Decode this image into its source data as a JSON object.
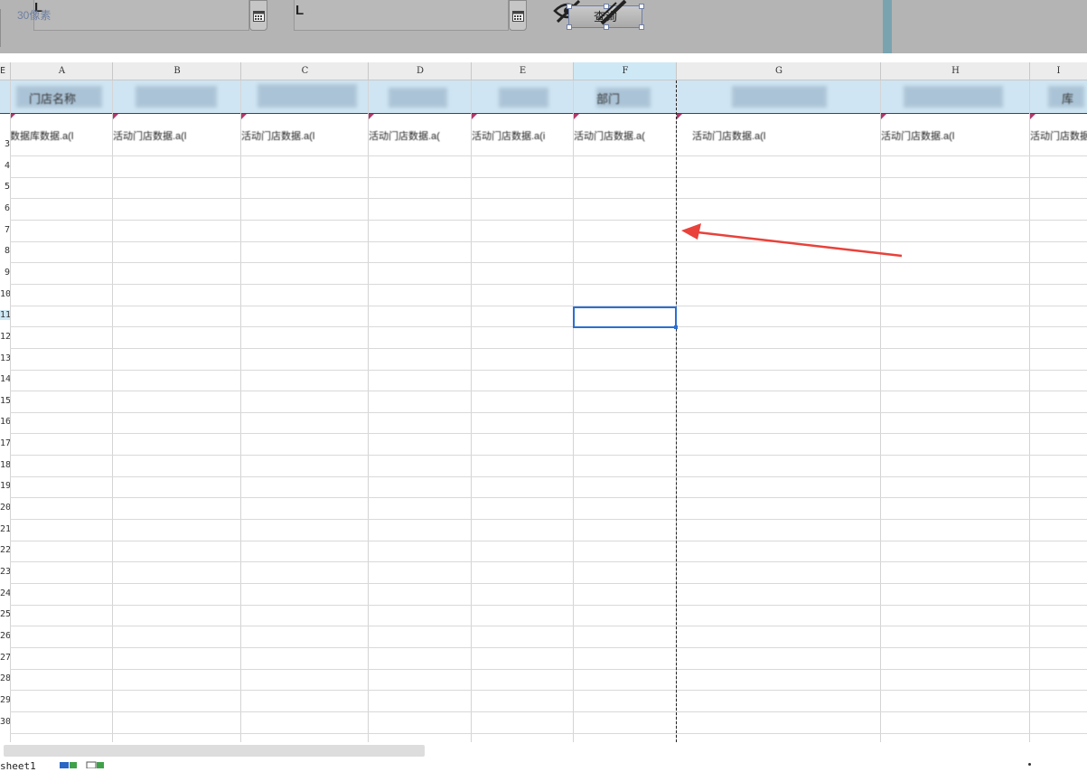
{
  "param_panel": {
    "field_label": "30像素",
    "query_button_label": "查询"
  },
  "columns": [
    "A",
    "B",
    "C",
    "D",
    "E",
    "F",
    "G",
    "H",
    "I"
  ],
  "corner_label": "E",
  "selected_column": "F",
  "header_band_texts": [
    "门店名称",
    "",
    "",
    "",
    "",
    "部门",
    "",
    "",
    "库"
  ],
  "row3_texts": [
    "数据库数据.a(l",
    "活动门店数据.a(l",
    "活动门店数据.a(l",
    "活动门店数据.a(",
    "活动门店数据.a(i",
    "活动门店数据.a(",
    "活动门店数据.a(l                  ",
    "活动门店数据.a(l",
    "活动门店数据"
  ],
  "row_numbers": [
    "3",
    "4",
    "5",
    "6",
    "7",
    "8",
    "9",
    "10",
    "11",
    "12",
    "13",
    "14",
    "15",
    "16",
    "17",
    "18",
    "19",
    "20",
    "21",
    "22",
    "23",
    "24",
    "25",
    "26",
    "27",
    "28",
    "29",
    "30"
  ],
  "sheet_tab": "sheet1",
  "active_cell": "F11",
  "colors": {
    "panel_bg": "#b4b4b4",
    "header_band": "#cfe5f3",
    "selection": "#2b6fd0",
    "arrow": "#e8423b"
  }
}
